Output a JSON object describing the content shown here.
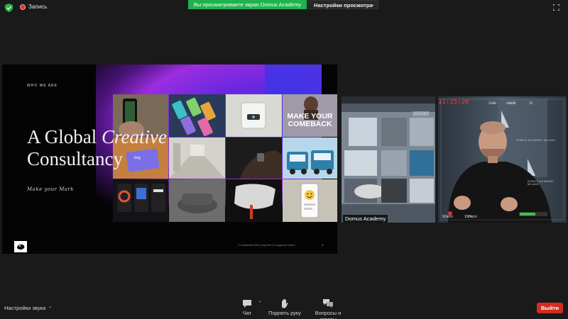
{
  "topbar": {
    "recording_label": "Запись",
    "share_banner": "Вы просматриваете экран Domus Academy",
    "view_options": "Настройки просмотра"
  },
  "slide": {
    "who_label": "WHO WE ARE",
    "headline_line1_regular": "A Global ",
    "headline_line1_italic": "Creative",
    "headline_line2": "Consultancy",
    "signature": "Make your Mark",
    "footer": "© confidential 2023 | frog Part of Capgemini Invent",
    "page_number": "3",
    "tile_make_your_comeback": "MAKE YOUR COMEBACK"
  },
  "video": {
    "participant_name": "Domus Academy",
    "timecode": "11:25:20",
    "camera_counter": "237547",
    "camera_stats": [
      "3200",
      "4000K",
      "15"
    ],
    "camera_bottom": [
      "92min",
      "190min"
    ],
    "wall_text_1": "DOMUS ACADEMY MILANO",
    "wall_text_2": "DOMUS ACADEMY MILANO"
  },
  "toolbar": {
    "audio_settings": "Настройки звука",
    "chat": "Чат",
    "raise_hand": "Поднять руку",
    "qa": "Вопросы и ответы",
    "leave": "Выйти"
  },
  "colors": {
    "background": "#1a1a1a",
    "share_banner": "#1fb34e",
    "leave_button": "#d32c22",
    "recording_dot": "#e0352b"
  }
}
